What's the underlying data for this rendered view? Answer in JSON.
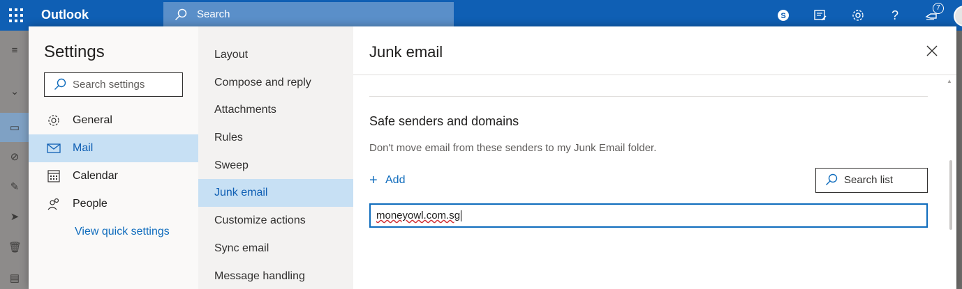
{
  "topbar": {
    "brand": "Outlook",
    "search_placeholder": "Search",
    "notification_count": "7"
  },
  "settings": {
    "title": "Settings",
    "search_placeholder": "Search settings",
    "categories": [
      {
        "label": "General",
        "icon": "gear-icon"
      },
      {
        "label": "Mail",
        "icon": "mail-icon",
        "selected": true
      },
      {
        "label": "Calendar",
        "icon": "calendar-icon"
      },
      {
        "label": "People",
        "icon": "people-icon"
      }
    ],
    "quick_settings_link": "View quick settings"
  },
  "mail_nav": {
    "items": [
      {
        "label": "Layout"
      },
      {
        "label": "Compose and reply"
      },
      {
        "label": "Attachments"
      },
      {
        "label": "Rules"
      },
      {
        "label": "Sweep"
      },
      {
        "label": "Junk email",
        "selected": true
      },
      {
        "label": "Customize actions"
      },
      {
        "label": "Sync email"
      },
      {
        "label": "Message handling"
      }
    ]
  },
  "junk": {
    "title": "Junk email",
    "section_title": "Safe senders and domains",
    "description": "Don't move email from these senders to my Junk Email folder.",
    "add_label": "Add",
    "search_list_label": "Search list",
    "entry_value": "moneyowl.com.sg"
  },
  "colors": {
    "accent": "#0f6cbd",
    "topbar": "#0f5fb4",
    "selected_bg": "#c7e0f4"
  }
}
